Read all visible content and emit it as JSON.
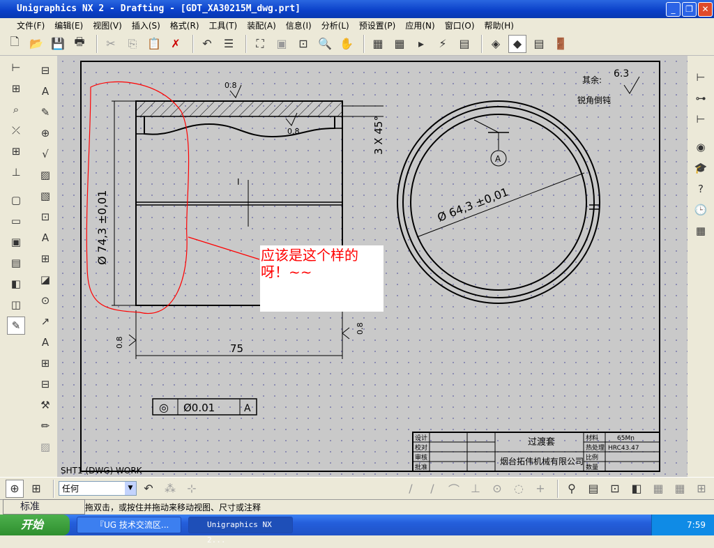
{
  "window": {
    "title": "Unigraphics NX 2 - Drafting - [GDT_XA30215M_dwg.prt]"
  },
  "menu": [
    "文件(F)",
    "编辑(E)",
    "视图(V)",
    "插入(S)",
    "格式(R)",
    "工具(T)",
    "装配(A)",
    "信息(I)",
    "分析(L)",
    "预设置(P)",
    "应用(N)",
    "窗口(O)",
    "帮助(H)"
  ],
  "drawing": {
    "roughness_rest_label": "其余:",
    "roughness_rest_value": "6.3",
    "deburr_note": "锐角倒钝",
    "roughness_values": [
      "0.8",
      "0.8",
      "0.8",
      "0.8"
    ],
    "chamfer": "3 X 45°",
    "outer_dia": "Ø 74,3 ±0,01",
    "length": "75",
    "inner_dia": "Ø 64,3 ±0,01",
    "datum": "A",
    "section_mark": "I",
    "fcf": {
      "symbol": "◎",
      "tolerance": "Ø0.01",
      "datum": "A"
    },
    "annotation": "应该是这个样的呀！~~",
    "sheet_label": "SHT1 (DWG) WORK"
  },
  "title_block": {
    "row_labels": [
      "设计",
      "校对",
      "审核",
      "批准"
    ],
    "part_name": "过渡套",
    "company": "烟台拓伟机械有限公司",
    "fields": [
      {
        "label": "材料",
        "value": "65Mn"
      },
      {
        "label": "热处理",
        "value": "HRC43.47"
      },
      {
        "label": "比例",
        "value": ""
      },
      {
        "label": "数量",
        "value": ""
      }
    ]
  },
  "selection_filter": {
    "value": "任何"
  },
  "status": "拖双击，或按住并拖动来移动视图、尺寸或注释",
  "ime": "标准",
  "taskbar": {
    "start": "开始",
    "tasks": [
      "『UG 技术交流区...",
      "Unigraphics NX 2..."
    ],
    "clock": "7:59"
  },
  "colors": {
    "titlebar": "#0a3fc8",
    "canvas": "#c9c9c9",
    "annotation_red": "#ff0000"
  }
}
